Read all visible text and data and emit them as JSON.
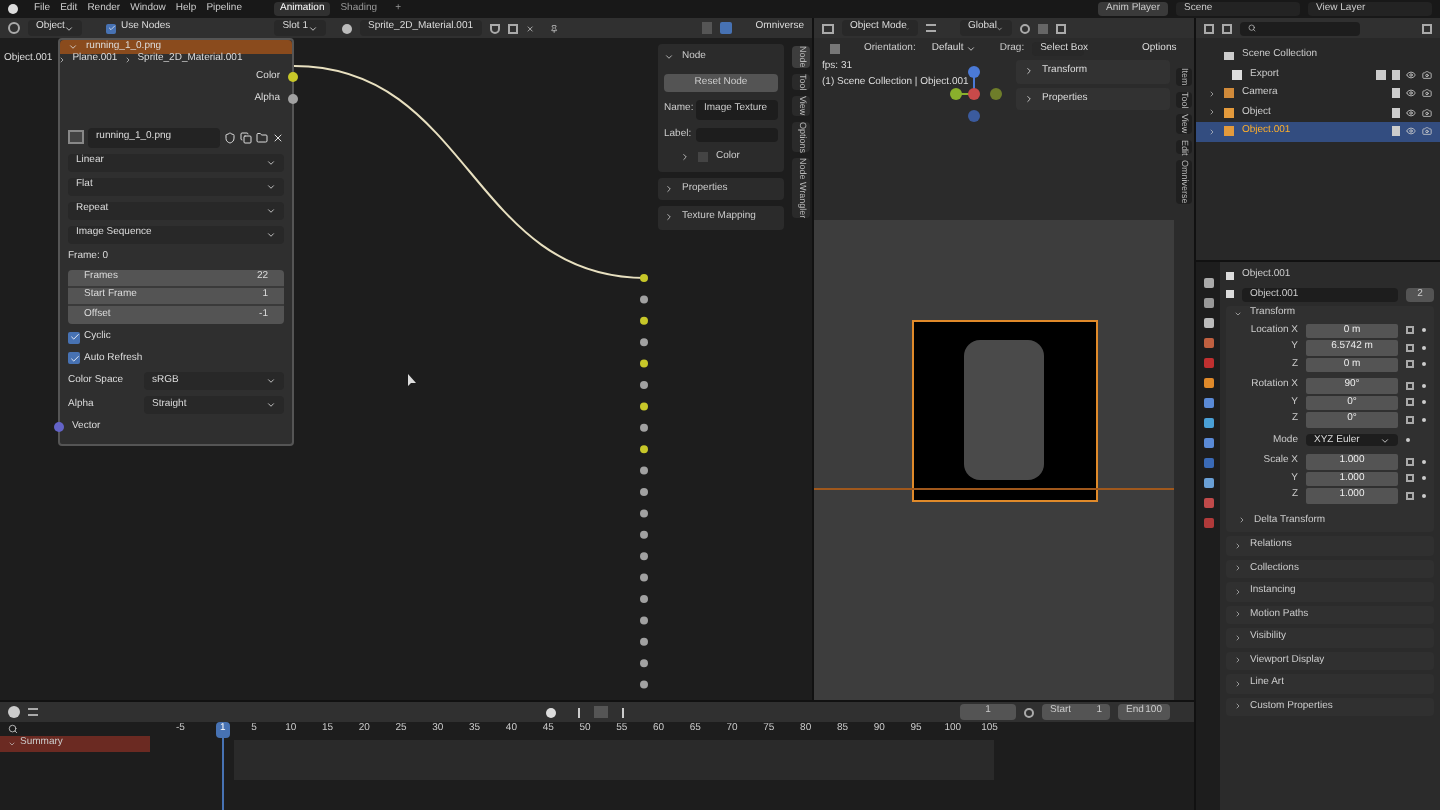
{
  "topbar": {
    "menus": [
      "File",
      "Edit",
      "Render",
      "Window",
      "Help",
      "Pipeline"
    ],
    "workspaces": [
      {
        "label": "Animation",
        "selected": true
      },
      {
        "label": "Shading",
        "selected": false
      }
    ],
    "add": "+",
    "anim_player": "Anim Player",
    "scene": "Scene",
    "view_layer": "View Layer"
  },
  "node_editor": {
    "header": {
      "mode": "Object",
      "use_nodes": {
        "label": "Use Nodes",
        "checked": true
      },
      "slot": "Slot 1",
      "material": "Sprite_2D_Material.001",
      "omniverse": "Omniverse"
    },
    "breadcrumb": [
      "Object.001",
      "Plane.001",
      "Sprite_2D_Material.001"
    ],
    "node": {
      "title": "running_1_0.png",
      "outputs": [
        "Color",
        "Alpha"
      ],
      "image": "running_1_0.png",
      "dropdowns": [
        "Linear",
        "Flat",
        "Repeat",
        "Image Sequence"
      ],
      "frame": "Frame: 0",
      "fields": [
        {
          "label": "Frames",
          "value": "22"
        },
        {
          "label": "Start Frame",
          "value": "1"
        },
        {
          "label": "Offset",
          "value": "-1"
        }
      ],
      "checks": [
        {
          "label": "Cyclic",
          "checked": true
        },
        {
          "label": "Auto Refresh",
          "checked": true
        }
      ],
      "selects": [
        {
          "label": "Color Space",
          "value": "sRGB"
        },
        {
          "label": "Alpha",
          "value": "Straight"
        }
      ],
      "input": "Vector"
    },
    "sidebar": {
      "panel": "Node",
      "reset": "Reset Node",
      "name_label": "Name:",
      "name": "Image Texture",
      "label_label": "Label:",
      "color_label": "Color",
      "sections": [
        "Properties",
        "Texture Mapping"
      ],
      "tabs": [
        {
          "label": "Node",
          "selected": true
        },
        {
          "label": "Tool",
          "selected": false
        },
        {
          "label": "View",
          "selected": false
        },
        {
          "label": "Options",
          "selected": false
        },
        {
          "label": "Node Wrangler",
          "selected": false
        }
      ]
    }
  },
  "viewport": {
    "header": {
      "mode": "Object Mode",
      "orientation": "Global"
    },
    "tool": {
      "orientation_label": "Orientation:",
      "orientation": "Default",
      "drag_label": "Drag:",
      "drag": "Select Box",
      "options": "Options"
    },
    "fps": "fps: 31",
    "context": "(1) Scene Collection | Object.001",
    "panels": [
      "Transform",
      "Properties"
    ],
    "tabs": [
      {
        "label": "Item",
        "selected": false
      },
      {
        "label": "Tool",
        "selected": false
      },
      {
        "label": "View",
        "selected": false
      },
      {
        "label": "Edit",
        "selected": false
      },
      {
        "label": "Omniverse",
        "selected": false
      }
    ]
  },
  "outliner": {
    "root": "Scene Collection",
    "items": [
      {
        "name": "Export",
        "kind": "collection",
        "selected": false
      },
      {
        "name": "Camera",
        "kind": "camera",
        "selected": false
      },
      {
        "name": "Object",
        "kind": "mesh",
        "selected": false
      },
      {
        "name": "Object.001",
        "kind": "mesh",
        "selected": true
      }
    ]
  },
  "properties": {
    "object": "Object.001",
    "data_name": "Object.001",
    "users": "2",
    "transform": "Transform",
    "rows": [
      {
        "label": "Location X",
        "value": "0 m",
        "kind": "field"
      },
      {
        "label": "Y",
        "value": "6.5742 m",
        "kind": "field"
      },
      {
        "label": "Z",
        "value": "0 m",
        "kind": "field"
      },
      {
        "label": "Rotation X",
        "value": "90°",
        "kind": "field"
      },
      {
        "label": "Y",
        "value": "0°",
        "kind": "field"
      },
      {
        "label": "Z",
        "value": "0°",
        "kind": "field"
      },
      {
        "label": "Mode",
        "value": "XYZ Euler",
        "kind": "select"
      },
      {
        "label": "Scale X",
        "value": "1.000",
        "kind": "field"
      },
      {
        "label": "Y",
        "value": "1.000",
        "kind": "field"
      },
      {
        "label": "Z",
        "value": "1.000",
        "kind": "field"
      }
    ],
    "delta": "Delta Transform",
    "sections": [
      "Relations",
      "Collections",
      "Instancing",
      "Motion Paths",
      "Visibility",
      "Viewport Display",
      "Line Art",
      "Custom Properties"
    ]
  },
  "timeline": {
    "frame": "1",
    "start_label": "Start",
    "start": "1",
    "end_label": "End",
    "end": "100",
    "current": "1",
    "ticks": [
      "-5",
      "5",
      "10",
      "15",
      "20",
      "25",
      "30",
      "35",
      "40",
      "45",
      "50",
      "55",
      "60",
      "65",
      "70",
      "75",
      "80",
      "85",
      "90",
      "95",
      "100",
      "105"
    ],
    "channel": "Summary"
  }
}
